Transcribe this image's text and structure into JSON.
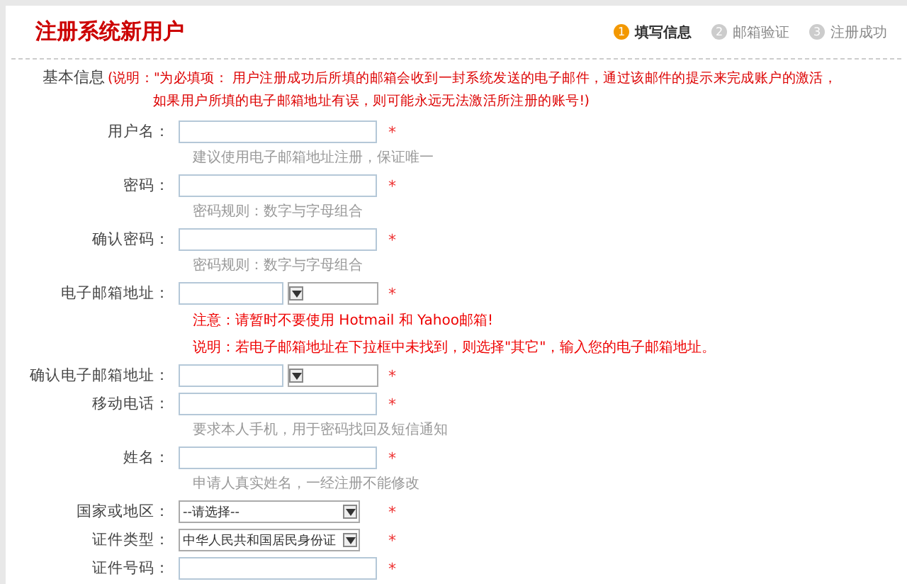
{
  "header": {
    "title": "注册系统新用户"
  },
  "steps": [
    {
      "number": "1",
      "label": "填写信息",
      "selected": true
    },
    {
      "number": "2",
      "label": "邮箱验证",
      "selected": false
    },
    {
      "number": "3",
      "label": "注册成功",
      "selected": false
    }
  ],
  "section": {
    "title": "基本信息",
    "note_lines": [
      "(说明：\"为必填项：  用户注册成功后所填的邮箱会收到一封系统发送的电子邮件，通过该邮件的提示来完成账户的激活，",
      "如果用户所填的电子邮箱地址有误，则可能永远无法激活所注册的账号!)"
    ]
  },
  "fields": [
    {
      "label": "用户名：",
      "kind": "text",
      "required_mark": "*",
      "hint": "建议使用电子邮箱地址注册，保证唯一"
    },
    {
      "label": "密码：",
      "kind": "text",
      "required_mark": "*",
      "hint": "密码规则：数字与字母组合"
    },
    {
      "label": "确认密码：",
      "kind": "text",
      "required_mark": "*",
      "hint": "密码规则：数字与字母组合"
    },
    {
      "label": "电子邮箱地址：",
      "kind": "email",
      "required_mark": "*",
      "notes": [
        "注意：请暂时不要使用 Hotmail 和 Yahoo邮箱!",
        "说明：若电子邮箱地址在下拉框中未找到，则选择\"其它\"，输入您的电子邮箱地址。"
      ]
    },
    {
      "label": "确认电子邮箱地址：",
      "kind": "email",
      "required_mark": "*"
    },
    {
      "label": "移动电话：",
      "kind": "text",
      "required_mark": "*",
      "hint": "要求本人手机，用于密码找回及短信通知"
    },
    {
      "label": "姓名：",
      "kind": "text",
      "required_mark": "*",
      "hint": "申请人真实姓名，一经注册不能修改"
    },
    {
      "label": "国家或地区：",
      "kind": "select",
      "value": "--请选择--",
      "required_mark": "*"
    },
    {
      "label": "证件类型：",
      "kind": "select",
      "value": "中华人民共和国居民身份证",
      "required_mark": "*"
    },
    {
      "label": "证件号码：",
      "kind": "text",
      "required_mark": "*"
    }
  ]
}
